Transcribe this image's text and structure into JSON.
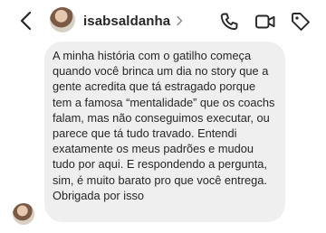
{
  "header": {
    "username": "isabsaldanha",
    "back_icon": "chevron-left-icon",
    "chevron_icon": "chevron-right-icon",
    "actions": [
      "phone-icon",
      "video-camera-icon",
      "tag-icon"
    ]
  },
  "message": {
    "text": "A minha história com o gatilho começa quando você brinca um dia no story que a gente acredita que tá estragado porque tem a famosa “mentalidade” que os coachs falam, mas não conseguimos executar, ou parece que tá tudo travado. Entendi exatamente os meus padrões e mudou tudo por aqui. E respondendo a pergunta, sim, é muito barato pro que você entrega. Obrigada por isso",
    "bubble_color": "#efefef"
  }
}
